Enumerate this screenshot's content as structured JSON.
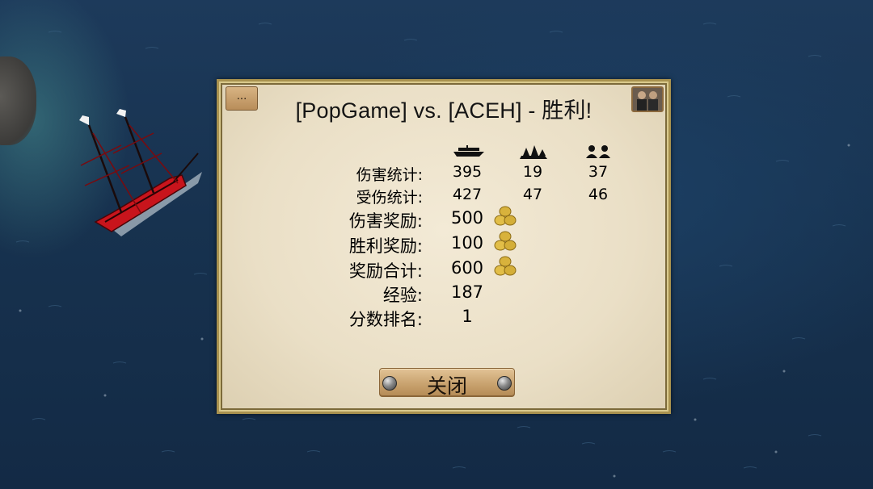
{
  "dialog": {
    "menu_label": "...",
    "title": "[PopGame] vs. [ACEH]  -  胜利!",
    "close_label": "关闭"
  },
  "columns": [
    {
      "icon": "ship-icon"
    },
    {
      "icon": "fleet-icon"
    },
    {
      "icon": "crew-icon"
    }
  ],
  "stats": {
    "damage_dealt": {
      "label": "伤害统计:",
      "values": [
        "395",
        "19",
        "37"
      ]
    },
    "damage_taken": {
      "label": "受伤统计:",
      "values": [
        "427",
        "47",
        "46"
      ]
    },
    "damage_reward": {
      "label": "伤害奖励:",
      "value": "500",
      "icon": "gold-coins-icon"
    },
    "victory_reward": {
      "label": "胜利奖励:",
      "value": "100",
      "icon": "gold-coins-icon"
    },
    "total_reward": {
      "label": "奖励合计:",
      "value": "600",
      "icon": "gold-coins-icon"
    },
    "experience": {
      "label": "经验:",
      "value": "187"
    },
    "rank": {
      "label": "分数排名:",
      "value": "1"
    }
  },
  "colors": {
    "panel_bg": "#eadfc6",
    "panel_border": "#a9924f",
    "sea": "#17324f",
    "ship_hull": "#c8141c",
    "button": "#c9a36f"
  }
}
